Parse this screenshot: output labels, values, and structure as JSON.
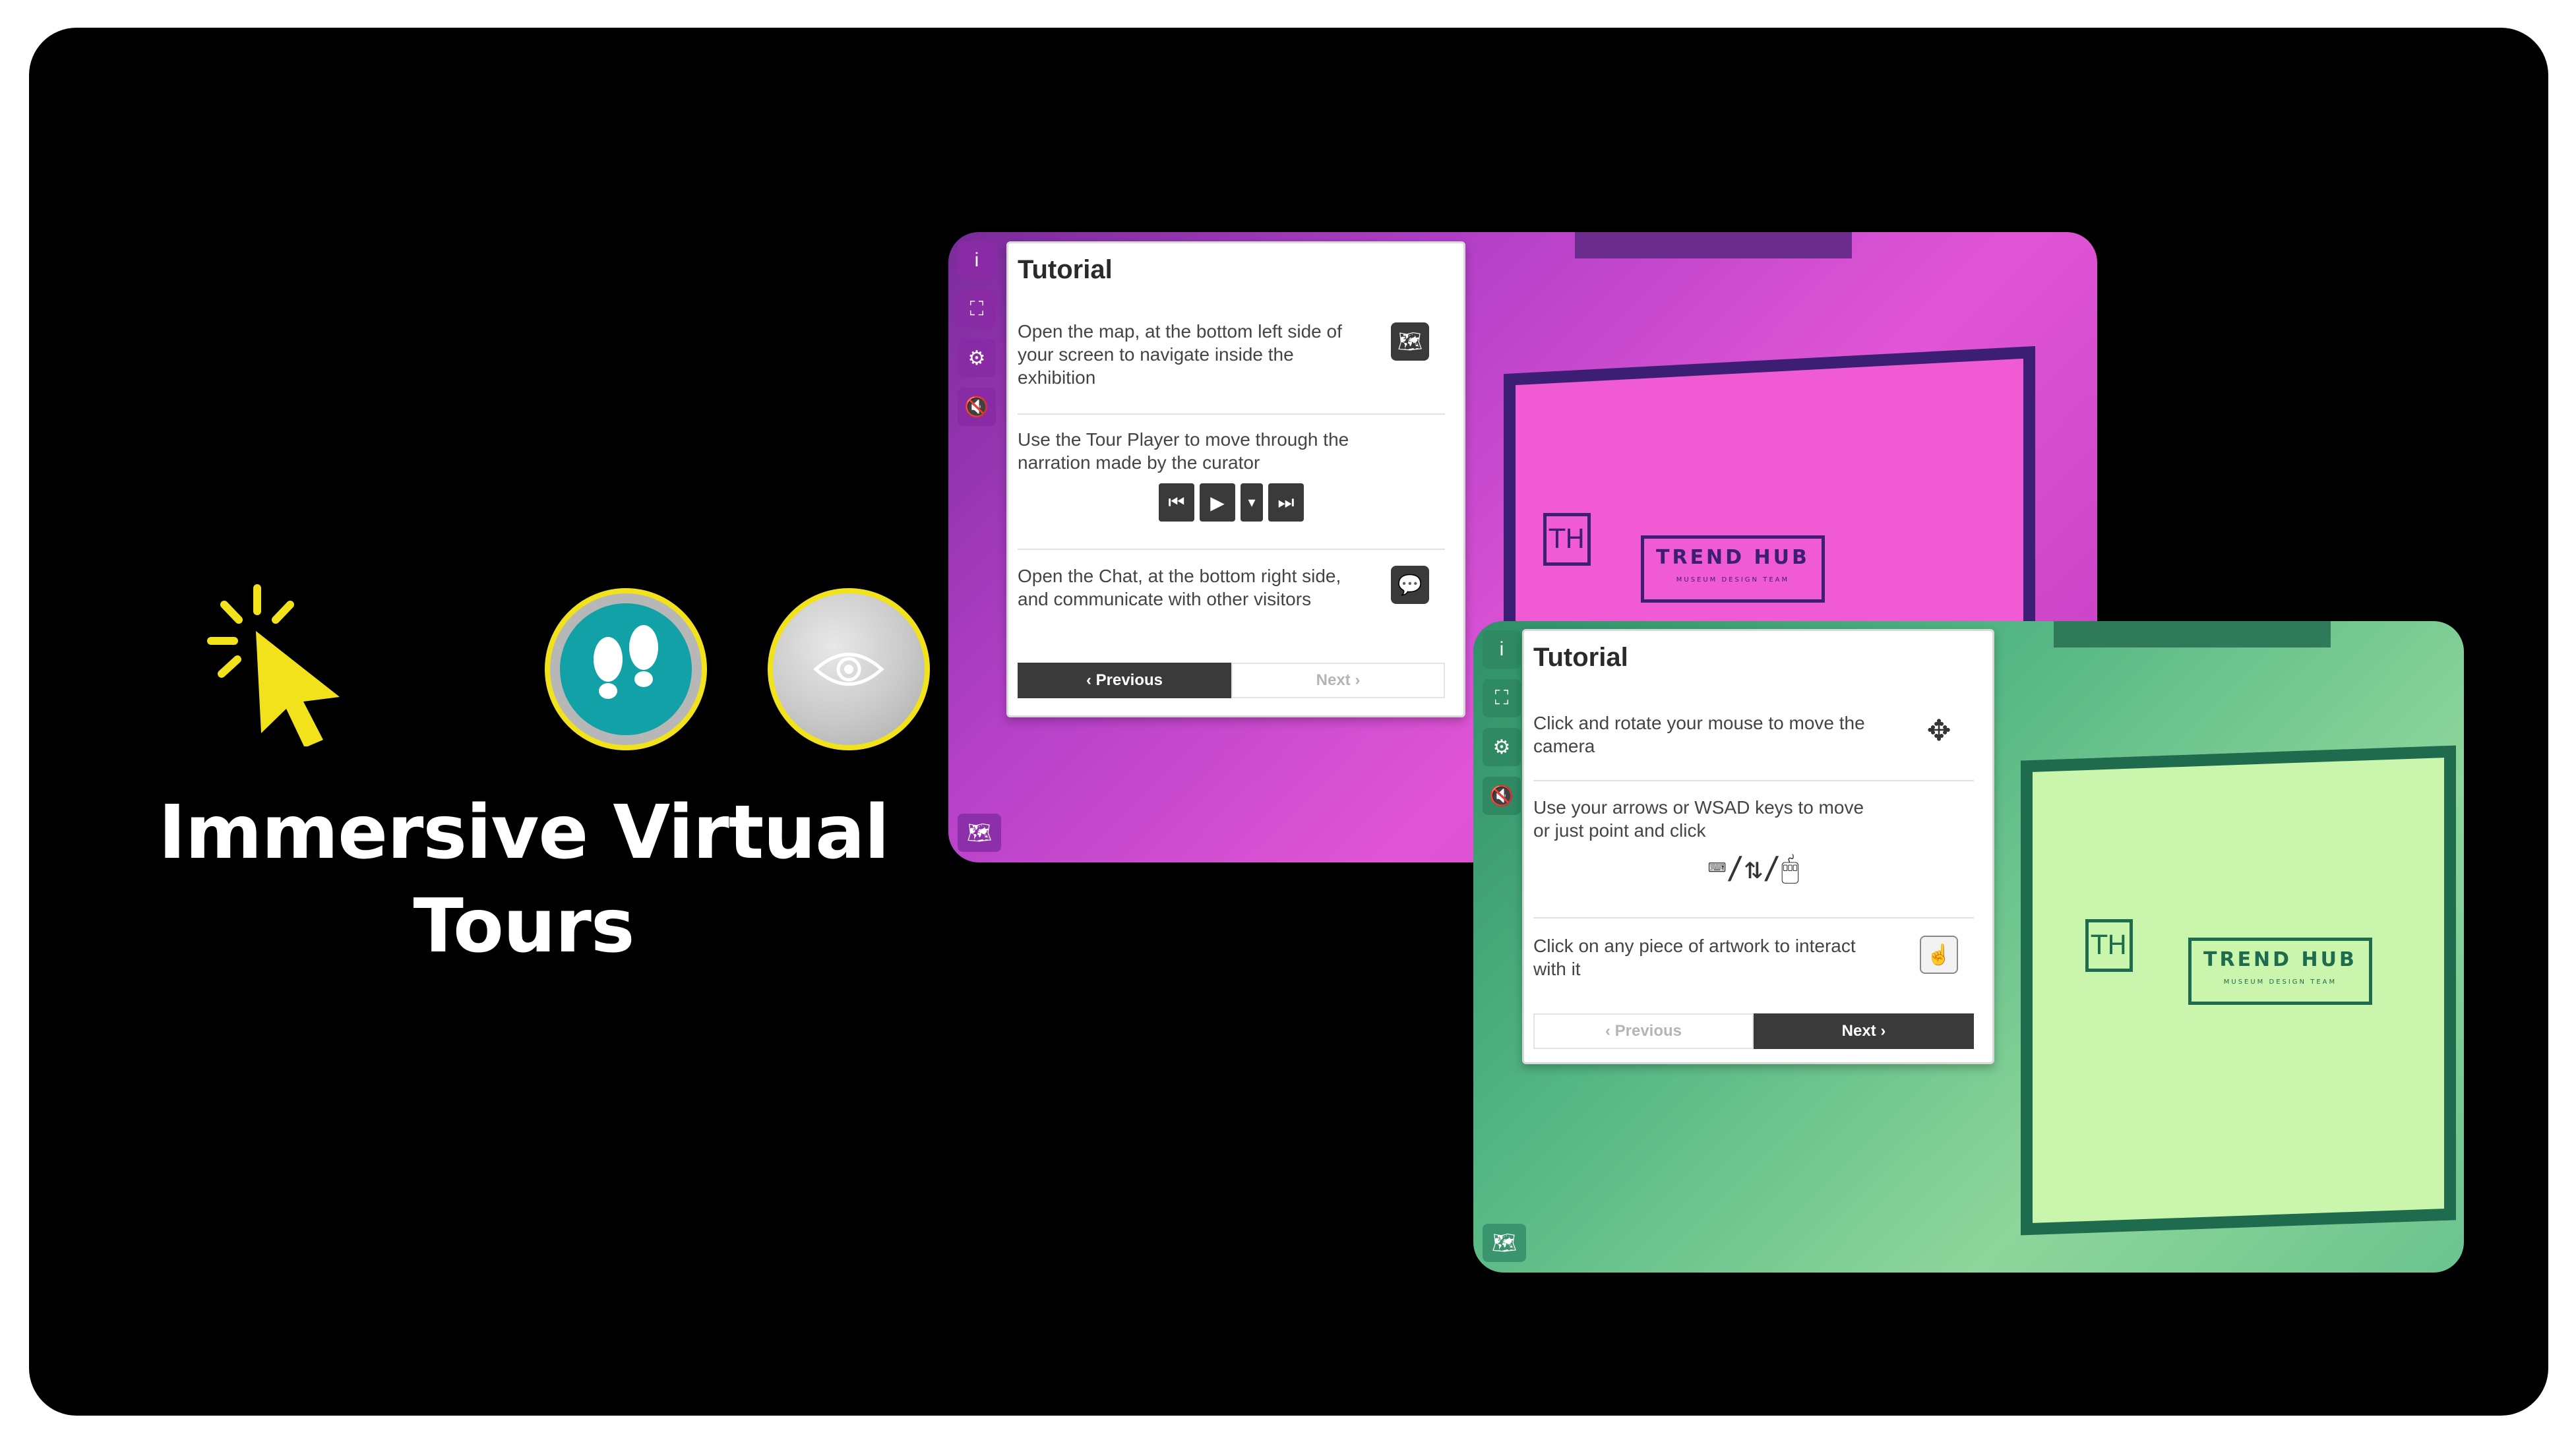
{
  "hero": {
    "title_line1": "Immersive Virtual",
    "title_line2": "Tours",
    "icons": [
      "cursor-click-icon",
      "footsteps-icon",
      "eye-icon"
    ],
    "accent_color": "#f2e21b",
    "teal_color": "#11a1a6"
  },
  "screens": [
    {
      "theme": "pink",
      "overlay_color": "#e155d6",
      "sidebar_icons": [
        "info-icon",
        "fullscreen-icon",
        "settings-icon",
        "mute-icon"
      ],
      "map_icon": "map-icon",
      "scene_logo_main": "TREND HUB",
      "scene_logo_sub": "MUSEUM DESIGN TEAM",
      "scene_monogram": "TH",
      "tutorial": {
        "title": "Tutorial",
        "rows": [
          {
            "text": "Open the map, at the bottom left side of your screen to navigate inside the exhibition",
            "icon": "map-icon"
          },
          {
            "text": "Use the Tour Player to move through the narration made by the curator",
            "icon": "tour-player-controls"
          },
          {
            "text": "Open the Chat, at the bottom right side, and communicate with other visitors",
            "icon": "chat-icon"
          }
        ],
        "prev_label": "Previous",
        "next_label": "Next",
        "active_button": "previous"
      }
    },
    {
      "theme": "green",
      "overlay_color": "#8ed69b",
      "sidebar_icons": [
        "info-icon",
        "fullscreen-icon",
        "settings-icon",
        "mute-icon"
      ],
      "map_icon": "map-icon",
      "scene_logo_main": "TREND HUB",
      "scene_logo_sub": "MUSEUM DESIGN TEAM",
      "scene_monogram": "TH",
      "tutorial": {
        "title": "Tutorial",
        "rows": [
          {
            "text": "Click and rotate your mouse to move the camera",
            "icon": "rotate-camera-icon"
          },
          {
            "text": "Use your arrows or WSAD keys to move or just point and click",
            "icon": "keyboard-mouse-icon"
          },
          {
            "text": "Click on any piece of artwork to interact with it",
            "icon": "click-artwork-icon"
          }
        ],
        "prev_label": "Previous",
        "next_label": "Next",
        "active_button": "next"
      }
    }
  ]
}
